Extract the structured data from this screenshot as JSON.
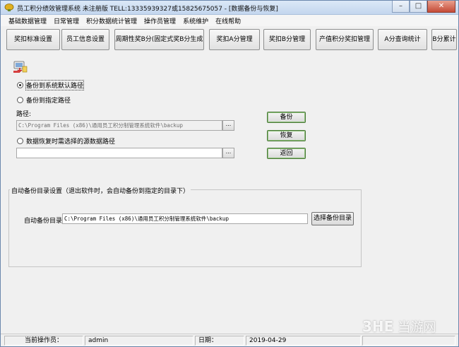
{
  "window": {
    "title": "员工积分绩效管理系统 未注册版 TELL:13335939327或15825675057 - [数据备份与恢复]",
    "minimize": "–",
    "maximize": "□",
    "close": "✕"
  },
  "menu": [
    "基础数据管理",
    "日常管理",
    "积分数据统计管理",
    "操作员管理",
    "系统维护",
    "在线帮助"
  ],
  "toolbar": [
    "奖扣标准设置",
    "员工信息设置",
    "周期性奖B分(固定式奖B分生成",
    "奖扣A分管理",
    "奖扣B分管理",
    "产值积分奖扣管理",
    "A分查询统计",
    "B分累计"
  ],
  "backup": {
    "radio_default": "备份到系统默认路径",
    "radio_custom": "备份到指定路径",
    "path_label": "路径:",
    "path_value": "C:\\Program Files (x86)\\通用员工积分制管理系统软件\\backup",
    "radio_restore": "数据恢复时需选择的源数据路径",
    "restore_value": "",
    "browse": "...",
    "buttons": {
      "backup": "备份",
      "restore": "恢复",
      "back": "返回"
    }
  },
  "auto": {
    "group_title": "自动备份目录设置（退出软件时，会自动备份到指定的目录下）",
    "label": "自动备份目录",
    "value": "C:\\Program Files (x86)\\通用员工积分制管理系统软件\\backup",
    "select_button": "选择备份目录"
  },
  "status": {
    "operator_label": "当前操作员：",
    "operator": "admin",
    "date_label": "日期：",
    "date": "2019-04-29"
  },
  "watermark": {
    "logo": "3HE",
    "text": "当游网"
  }
}
